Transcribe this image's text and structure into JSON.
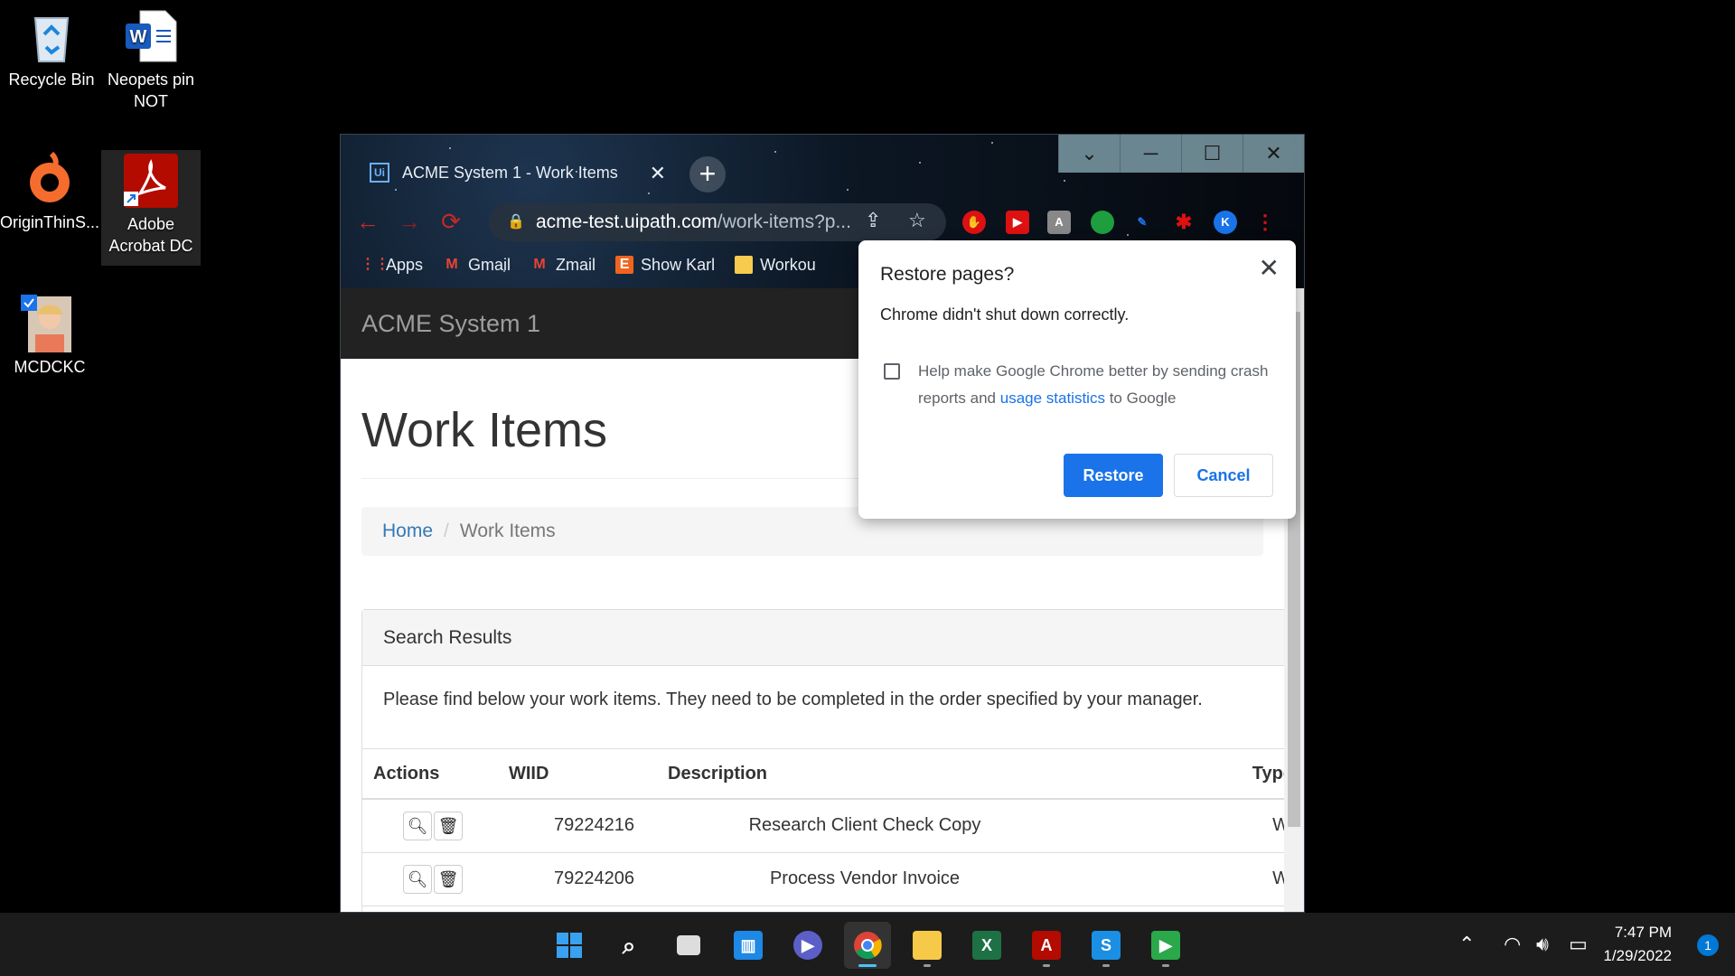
{
  "desktop": {
    "icons": [
      {
        "label": "Recycle Bin"
      },
      {
        "label": "Neopets pin NOT"
      },
      {
        "label": "OriginThinS..."
      },
      {
        "label": "Adobe Acrobat DC"
      },
      {
        "label": "MCDCKC"
      }
    ]
  },
  "browser": {
    "tab_title": "ACME System 1 - Work Items",
    "url_host": "acme-test.uipath.com",
    "url_path": "/work-items?p...",
    "extension_avatar": "K",
    "bookmarks": [
      {
        "label": "Apps",
        "icon": "apps-grid-icon"
      },
      {
        "label": "Gmail",
        "icon": "gmail-icon"
      },
      {
        "label": "Zmail",
        "icon": "gmail-icon"
      },
      {
        "label": "Show Karl",
        "icon": "etsy-icon"
      },
      {
        "label": "Workou",
        "icon": "folder-icon"
      }
    ]
  },
  "page": {
    "app_name": "ACME System 1",
    "title": "Work Items",
    "breadcrumb": {
      "home": "Home",
      "current": "Work Items"
    },
    "panel_heading": "Search Results",
    "panel_text": "Please find below your work items. They need to be completed in the order specified by your manager.",
    "table": {
      "headers": [
        "Actions",
        "WIID",
        "Description",
        "Type"
      ],
      "rows": [
        {
          "wiid": "79224216",
          "description": "Research Client Check Copy",
          "type": "W"
        },
        {
          "wiid": "79224206",
          "description": "Process Vendor Invoice",
          "type": "W"
        }
      ]
    }
  },
  "dialog": {
    "title": "Restore pages?",
    "message": "Chrome didn't shut down correctly.",
    "optin_prefix": "Help make Google Chrome better by sending crash reports and ",
    "optin_link": "usage statistics",
    "optin_suffix": " to Google",
    "optin_checked": false,
    "restore_label": "Restore",
    "cancel_label": "Cancel"
  },
  "taskbar": {
    "time": "7:47 PM",
    "date": "1/29/2022",
    "notification_count": "1"
  },
  "colors": {
    "accent": "#1a73e8",
    "link": "#337ab7",
    "navbar": "#222222"
  }
}
